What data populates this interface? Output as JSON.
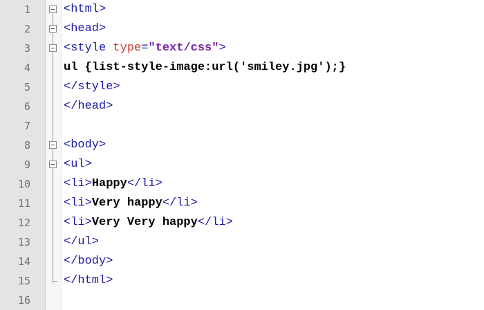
{
  "editor": {
    "lines": [
      {
        "num": "1",
        "segments": [
          {
            "cls": "tag",
            "t": "<html>"
          }
        ],
        "fold": "open"
      },
      {
        "num": "2",
        "segments": [
          {
            "cls": "tag",
            "t": "<head>"
          }
        ],
        "fold": "open"
      },
      {
        "num": "3",
        "segments": [
          {
            "cls": "tag",
            "t": "<style "
          },
          {
            "cls": "attr",
            "t": "type"
          },
          {
            "cls": "tag",
            "t": "="
          },
          {
            "cls": "attrval",
            "t": "\"text/css\""
          },
          {
            "cls": "tag",
            "t": ">"
          }
        ],
        "fold": "open"
      },
      {
        "num": "4",
        "segments": [
          {
            "cls": "plain",
            "t": "ul {list-style-image:url('smiley.jpg');}"
          }
        ],
        "fold": "line"
      },
      {
        "num": "5",
        "segments": [
          {
            "cls": "tag",
            "t": "</style>"
          }
        ],
        "fold": "line"
      },
      {
        "num": "6",
        "segments": [
          {
            "cls": "tag",
            "t": "</head>"
          }
        ],
        "fold": "line"
      },
      {
        "num": "7",
        "segments": [],
        "fold": "line"
      },
      {
        "num": "8",
        "segments": [
          {
            "cls": "tag",
            "t": "<body>"
          }
        ],
        "fold": "open"
      },
      {
        "num": "9",
        "segments": [
          {
            "cls": "tag",
            "t": "<ul>"
          }
        ],
        "fold": "open"
      },
      {
        "num": "10",
        "segments": [
          {
            "cls": "tag",
            "t": "<li>"
          },
          {
            "cls": "plain",
            "t": "Happy"
          },
          {
            "cls": "tag",
            "t": "</li>"
          }
        ],
        "fold": "line"
      },
      {
        "num": "11",
        "segments": [
          {
            "cls": "tag",
            "t": "<li>"
          },
          {
            "cls": "plain",
            "t": "Very happy"
          },
          {
            "cls": "tag",
            "t": "</li>"
          }
        ],
        "fold": "line"
      },
      {
        "num": "12",
        "segments": [
          {
            "cls": "tag",
            "t": "<li>"
          },
          {
            "cls": "plain",
            "t": "Very Very happy"
          },
          {
            "cls": "tag",
            "t": "</li>"
          }
        ],
        "fold": "line"
      },
      {
        "num": "13",
        "segments": [
          {
            "cls": "tag",
            "t": "</ul>"
          }
        ],
        "fold": "line"
      },
      {
        "num": "14",
        "segments": [
          {
            "cls": "tag",
            "t": "</body>"
          }
        ],
        "fold": "line"
      },
      {
        "num": "15",
        "segments": [
          {
            "cls": "tag",
            "t": "</html>"
          }
        ],
        "fold": "end"
      },
      {
        "num": "16",
        "segments": [],
        "fold": "none"
      }
    ],
    "colors": {
      "tag": "#1a1aa6",
      "attribute": "#c0392b",
      "attribute_value": "#7a1fa2",
      "plain_text": "#000000",
      "gutter": "#e4e4e4"
    }
  }
}
